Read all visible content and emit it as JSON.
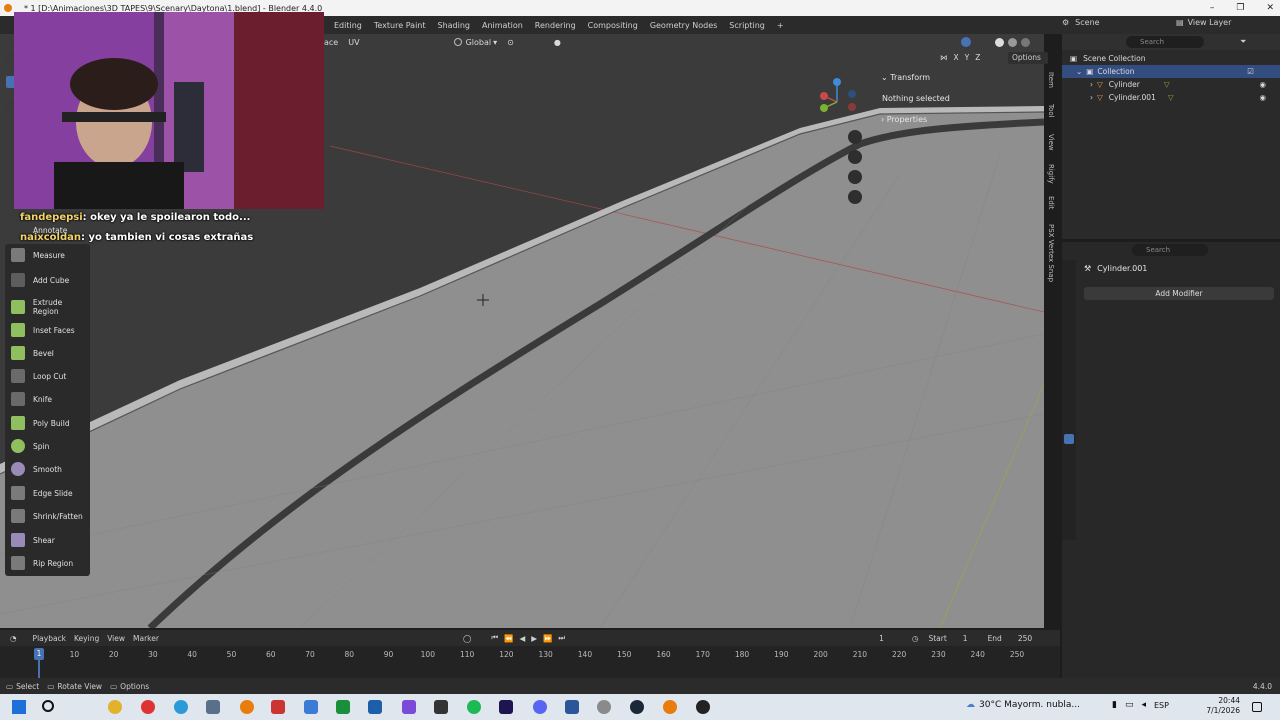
{
  "window": {
    "title": "* 1 [D:\\Animaciones\\3D TAPES\\9\\Scenary\\Daytona\\1.blend] - Blender 4.4.0",
    "controls": [
      "–",
      "❐",
      "✕"
    ]
  },
  "workspace_tabs": [
    "Editing",
    "Texture Paint",
    "Shading",
    "Animation",
    "Rendering",
    "Compositing",
    "Geometry Nodes",
    "Scripting",
    "+"
  ],
  "viewport_header": {
    "mode_fragment": "ace",
    "uv_menu": "UV",
    "orientation": "Global",
    "options_label": "Options",
    "axes": [
      "X",
      "Y",
      "Z"
    ]
  },
  "chat": [
    {
      "user": "fandepepsi",
      "message": "okey ya le spoilearon todo..."
    },
    {
      "user": "naixcoldan",
      "message": "yo tambien vi cosas extrañas"
    }
  ],
  "toolbar": {
    "tools": [
      "Annotate",
      "Measure",
      "Add Cube",
      "Extrude Region",
      "Inset Faces",
      "Bevel",
      "Loop Cut",
      "Knife",
      "Poly Build",
      "Spin",
      "Smooth",
      "Edge Slide",
      "Shrink/Fatten",
      "Shear",
      "Rip Region"
    ]
  },
  "npanel": {
    "transform_label": "Transform",
    "nothing_selected": "Nothing selected",
    "properties_label": "Properties",
    "vertical_tabs": [
      "Item",
      "Tool",
      "View",
      "Rigify",
      "Edit",
      "PSX Vertex Snap"
    ]
  },
  "outliner": {
    "scene_label": "Scene",
    "viewlayer_label": "View Layer",
    "search_placeholder": "Search",
    "scene_collection": "Scene Collection",
    "collection": "Collection",
    "objects": [
      "Cylinder",
      "Cylinder.001"
    ]
  },
  "properties": {
    "search_placeholder": "Search",
    "object_name": "Cylinder.001",
    "add_modifier": "Add Modifier"
  },
  "timeline": {
    "menus": [
      "Playback",
      "Keying",
      "View",
      "Marker"
    ],
    "current_frame": "1",
    "start_label": "Start",
    "start_value": "1",
    "end_label": "End",
    "end_value": "250",
    "ticks": [
      "1",
      "10",
      "20",
      "30",
      "40",
      "50",
      "60",
      "70",
      "80",
      "90",
      "100",
      "110",
      "120",
      "130",
      "140",
      "150",
      "160",
      "170",
      "180",
      "190",
      "200",
      "210",
      "220",
      "230",
      "240",
      "250"
    ],
    "marker_frame": "1"
  },
  "statusbar": {
    "select": "Select",
    "rotate_view": "Rotate View",
    "options": "Options",
    "version": "4.4.0"
  },
  "taskbar": {
    "weather": "30°C  Mayorm. nubla...",
    "language": "ESP",
    "time": "20:44",
    "date": "7/1/2026"
  },
  "colors": {
    "accent": "#4772b3",
    "x_axis": "#c84a4a",
    "y_axis": "#7bb32e",
    "z_axis": "#3f8bd9",
    "webcam_magenta": "#b44fd8"
  }
}
